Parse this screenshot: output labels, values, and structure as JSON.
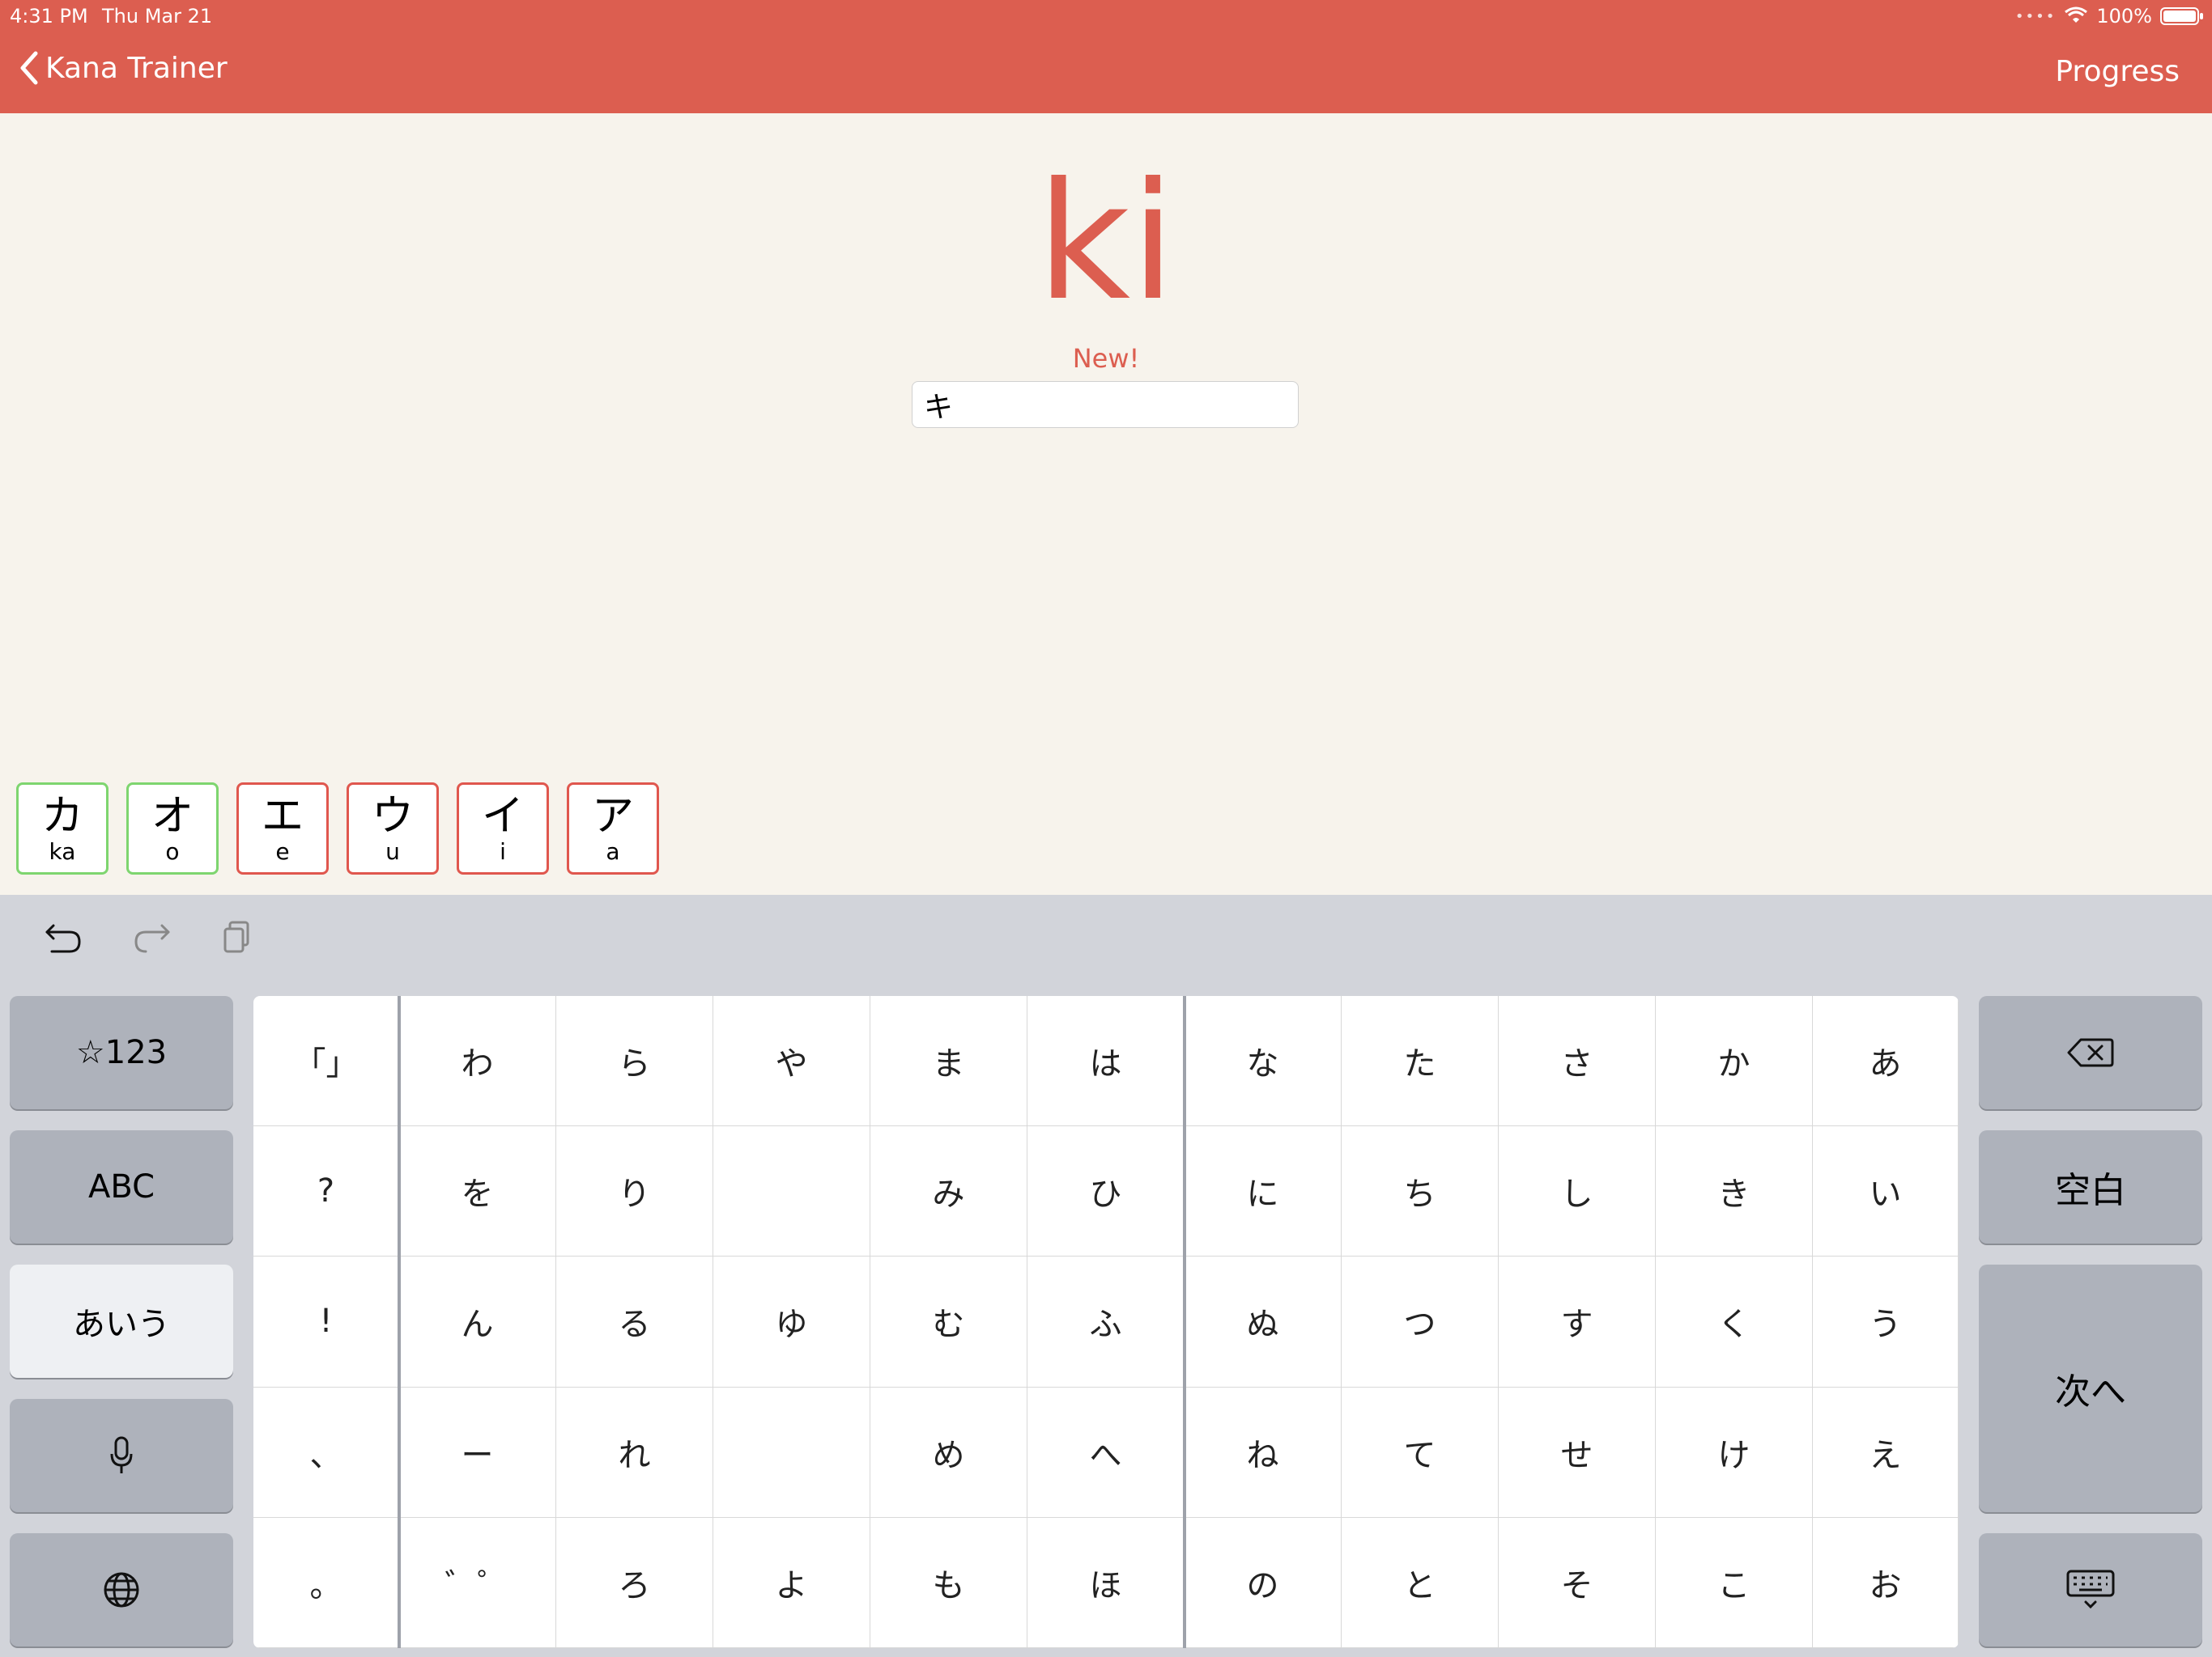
{
  "status": {
    "time": "4:31 PM",
    "date": "Thu Mar 21",
    "battery": "100%"
  },
  "nav": {
    "back_label": "Kana Trainer",
    "right_label": "Progress"
  },
  "prompt": {
    "romaji": "ki",
    "badge": "New!",
    "answer_value": "キ"
  },
  "history": [
    {
      "kana": "カ",
      "romaji": "ka",
      "result": "correct"
    },
    {
      "kana": "オ",
      "romaji": "o",
      "result": "correct"
    },
    {
      "kana": "エ",
      "romaji": "e",
      "result": "incorrect"
    },
    {
      "kana": "ウ",
      "romaji": "u",
      "result": "incorrect"
    },
    {
      "kana": "イ",
      "romaji": "i",
      "result": "incorrect"
    },
    {
      "kana": "ア",
      "romaji": "a",
      "result": "incorrect"
    }
  ],
  "keyboard": {
    "left": [
      "☆123",
      "ABC",
      "あいう"
    ],
    "right": {
      "space": "空白",
      "next": "次へ"
    },
    "grid": [
      [
        "「」",
        "わ",
        "ら",
        "や",
        "ま",
        "は",
        "な",
        "た",
        "さ",
        "か",
        "あ"
      ],
      [
        "?",
        "を",
        "り",
        "",
        "み",
        "ひ",
        "に",
        "ち",
        "し",
        "き",
        "い"
      ],
      [
        "!",
        "ん",
        "る",
        "ゆ",
        "む",
        "ふ",
        "ぬ",
        "つ",
        "す",
        "く",
        "う"
      ],
      [
        "、",
        "ー",
        "れ",
        "",
        "め",
        "へ",
        "ね",
        "て",
        "せ",
        "け",
        "え"
      ],
      [
        "。",
        "゛゜",
        "ろ",
        "よ",
        "も",
        "ほ",
        "の",
        "と",
        "そ",
        "こ",
        "お"
      ]
    ]
  },
  "colors": {
    "accent": "#dc5e50",
    "correct": "#7ed56f",
    "incorrect": "#e0574e",
    "background": "#f7f3ec",
    "keyboard": "#d2d4da"
  }
}
